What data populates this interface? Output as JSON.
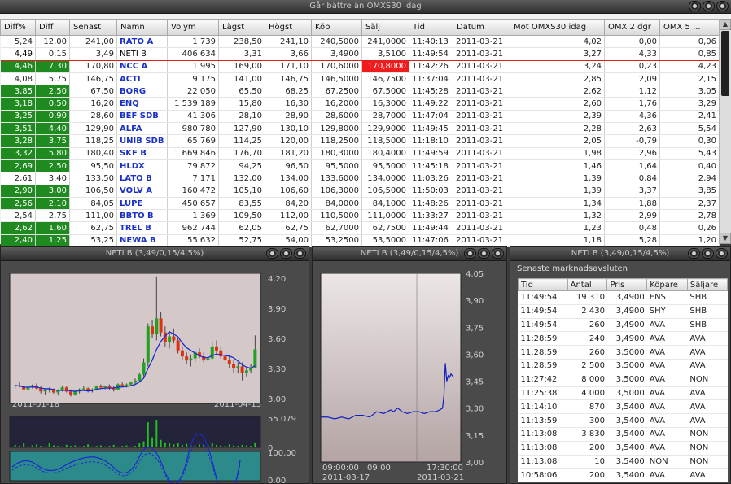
{
  "window": {
    "title": "Går bättre än OMXS30 idag"
  },
  "columns": [
    "Diff%",
    "Diff",
    "Senast",
    "Namn",
    "Volym",
    "Lägst",
    "Högst",
    "Köp",
    "Sälj",
    "Tid",
    "Datum",
    "Mot OMXS30 idag",
    "OMX 2 dgr",
    "OMX 5 ..."
  ],
  "rows": [
    [
      "5,24",
      "12,00",
      "241,00",
      "RATO A",
      "1 739",
      "238,50",
      "241,10",
      "240,5000",
      "241,0000",
      "11:40:13",
      "2011-03-21",
      "4,02",
      "0,00",
      "0,06"
    ],
    [
      "4,49",
      "0,15",
      "3,49",
      "NETI B",
      "406 634",
      "3,31",
      "3,66",
      "3,4900",
      "3,5100",
      "11:49:54",
      "2011-03-21",
      "3,27",
      "4,33",
      "0,85"
    ],
    [
      "4,46",
      "7,30",
      "170,80",
      "NCC A",
      "1 995",
      "169,00",
      "171,10",
      "170,6000",
      "170,8000",
      "11:42:26",
      "2011-03-21",
      "3,24",
      "0,23",
      "4,23"
    ],
    [
      "4,08",
      "5,75",
      "146,75",
      "ACTI",
      "9 175",
      "141,00",
      "146,75",
      "146,5000",
      "146,7500",
      "11:37:04",
      "2011-03-21",
      "2,85",
      "2,09",
      "2,15"
    ],
    [
      "3,85",
      "2,50",
      "67,50",
      "BORG",
      "22 050",
      "65,50",
      "68,25",
      "67,2500",
      "67,5000",
      "11:45:28",
      "2011-03-21",
      "2,62",
      "1,12",
      "3,05"
    ],
    [
      "3,18",
      "0,50",
      "16,20",
      "ENQ",
      "1 539 189",
      "15,80",
      "16,30",
      "16,2000",
      "16,3000",
      "11:49:22",
      "2011-03-21",
      "2,60",
      "1,76",
      "3,29"
    ],
    [
      "3,25",
      "0,90",
      "28,60",
      "BEF SDB",
      "41 306",
      "28,10",
      "28,90",
      "28,6000",
      "28,7000",
      "11:47:04",
      "2011-03-21",
      "2,39",
      "4,36",
      "2,41"
    ],
    [
      "3,51",
      "4,40",
      "129,90",
      "ALFA",
      "980 780",
      "127,90",
      "130,10",
      "129,8000",
      "129,9000",
      "11:49:45",
      "2011-03-21",
      "2,28",
      "2,63",
      "5,54"
    ],
    [
      "3,28",
      "3,75",
      "118,25",
      "UNIB SDB",
      "65 769",
      "114,25",
      "120,00",
      "118,2500",
      "118,5000",
      "11:18:10",
      "2011-03-21",
      "2,05",
      "-0,79",
      "0,30"
    ],
    [
      "3,32",
      "5,80",
      "180,40",
      "SKF B",
      "1 669 846",
      "176,70",
      "181,20",
      "180,3000",
      "180,4000",
      "11:49:59",
      "2011-03-21",
      "1,98",
      "2,96",
      "5,43"
    ],
    [
      "2,69",
      "2,50",
      "95,50",
      "HLDX",
      "79 872",
      "94,25",
      "96,50",
      "95,5000",
      "95,5000",
      "11:45:18",
      "2011-03-21",
      "1,46",
      "1,64",
      "0,40"
    ],
    [
      "2,61",
      "3,40",
      "133,50",
      "LATO B",
      "7 171",
      "132,00",
      "134,00",
      "133,6000",
      "134,0000",
      "11:03:26",
      "2011-03-21",
      "1,39",
      "0,84",
      "2,94"
    ],
    [
      "2,90",
      "3,00",
      "106,50",
      "VOLV A",
      "160 472",
      "105,10",
      "106,60",
      "106,3000",
      "106,5000",
      "11:50:03",
      "2011-03-21",
      "1,39",
      "3,37",
      "3,85"
    ],
    [
      "2,56",
      "2,10",
      "84,05",
      "LUPE",
      "450 657",
      "83,55",
      "84,20",
      "84,0000",
      "84,1000",
      "11:48:26",
      "2011-03-21",
      "1,34",
      "1,88",
      "2,37"
    ],
    [
      "2,54",
      "2,75",
      "111,00",
      "BBTO B",
      "1 369",
      "109,50",
      "112,00",
      "110,5000",
      "111,0000",
      "11:33:27",
      "2011-03-21",
      "1,32",
      "2,99",
      "2,78"
    ],
    [
      "2,62",
      "1,60",
      "62,75",
      "TREL B",
      "962 744",
      "62,05",
      "62,75",
      "62,7000",
      "62,7500",
      "11:49:44",
      "2011-03-21",
      "1,23",
      "0,48",
      "0,26"
    ],
    [
      "2,40",
      "1,25",
      "53,25",
      "NEWA B",
      "55 632",
      "52,75",
      "54,00",
      "53,2500",
      "53,5000",
      "11:47:06",
      "2011-03-21",
      "1,18",
      "5,28",
      "1,20"
    ]
  ],
  "rowColors": [
    "w",
    "g",
    "g",
    "w",
    "g",
    "g",
    "g",
    "g",
    "g",
    "g",
    "g",
    "w",
    "g",
    "g",
    "w",
    "g",
    "g"
  ],
  "diffColors": [
    "w",
    "w",
    "g",
    "w",
    "g",
    "g",
    "g",
    "g",
    "g",
    "g",
    "g",
    "w",
    "g",
    "g",
    "w",
    "g",
    "g"
  ],
  "chart1": {
    "title": "NETI B (3,49/0,15/4,5%)",
    "date_start": "2011-01-18",
    "date_end": "2011-04-15",
    "y_ticks": [
      "4,20",
      "3,90",
      "3,60",
      "3,30",
      "3,00"
    ],
    "vol_ticks": [
      "55 079",
      "0"
    ],
    "osc_ticks": [
      "100,00",
      "0,00"
    ]
  },
  "chart2": {
    "title": "NETI B (3,49/0,15/4,5%)",
    "y_ticks": [
      "4,05",
      "3,90",
      "3,75",
      "3,60",
      "3,45",
      "3,30",
      "3,15",
      "3,00"
    ],
    "x_top": [
      "09:00:00",
      "09:00",
      "17:30:00"
    ],
    "x_bot": [
      "2011-03-17",
      "2011-03-21"
    ]
  },
  "trades": {
    "title": "NETI B (3,49/0,15/4,5%)",
    "subtitle": "Senaste marknadsavsluten",
    "headers": [
      "Tid",
      "Antal",
      "Pris",
      "Köpare",
      "Säljare"
    ],
    "rows": [
      [
        "11:49:54",
        "19 310",
        "3,4900",
        "ENS",
        "SHB"
      ],
      [
        "11:49:54",
        "2 430",
        "3,4900",
        "SHY",
        "SHB"
      ],
      [
        "11:49:54",
        "260",
        "3,4900",
        "AVA",
        "SHB"
      ],
      [
        "11:28:59",
        "240",
        "3,4900",
        "AVA",
        "AVA"
      ],
      [
        "11:28:59",
        "260",
        "3,5000",
        "AVA",
        "AVA"
      ],
      [
        "11:28:59",
        "2 500",
        "3,5000",
        "AVA",
        "AVA"
      ],
      [
        "11:27:42",
        "8 000",
        "3,5000",
        "AVA",
        "NON"
      ],
      [
        "11:25:38",
        "4 000",
        "3,5000",
        "AVA",
        "AVA"
      ],
      [
        "11:14:10",
        "870",
        "3,5400",
        "AVA",
        "AVA"
      ],
      [
        "11:13:59",
        "300",
        "3,5400",
        "AVA",
        "AVA"
      ],
      [
        "11:13:08",
        "3 830",
        "3,5400",
        "AVA",
        "NON"
      ],
      [
        "11:13:08",
        "200",
        "3,5400",
        "AVA",
        "NON"
      ],
      [
        "11:13:08",
        "10",
        "3,5400",
        "NON",
        "NON"
      ],
      [
        "10:58:06",
        "200",
        "3,5400",
        "AVA",
        "AVA"
      ]
    ]
  },
  "chart_data": {
    "type": "candlestick",
    "candles": [
      [
        3.12,
        3.14,
        3.1,
        3.13
      ],
      [
        3.13,
        3.16,
        3.11,
        3.12
      ],
      [
        3.12,
        3.13,
        3.08,
        3.09
      ],
      [
        3.09,
        3.12,
        3.07,
        3.11
      ],
      [
        3.11,
        3.14,
        3.1,
        3.13
      ],
      [
        3.13,
        3.15,
        3.09,
        3.1
      ],
      [
        3.1,
        3.12,
        3.05,
        3.07
      ],
      [
        3.07,
        3.1,
        3.04,
        3.08
      ],
      [
        3.08,
        3.11,
        3.06,
        3.09
      ],
      [
        3.09,
        3.1,
        3.05,
        3.06
      ],
      [
        3.06,
        3.09,
        3.03,
        3.08
      ],
      [
        3.08,
        3.12,
        3.07,
        3.11
      ],
      [
        3.11,
        3.12,
        3.06,
        3.07
      ],
      [
        3.07,
        3.09,
        3.02,
        3.04
      ],
      [
        3.04,
        3.08,
        3.03,
        3.07
      ],
      [
        3.07,
        3.1,
        3.05,
        3.09
      ],
      [
        3.09,
        3.12,
        3.08,
        3.1
      ],
      [
        3.1,
        3.11,
        3.06,
        3.08
      ],
      [
        3.08,
        3.1,
        3.06,
        3.09
      ],
      [
        3.09,
        3.13,
        3.08,
        3.12
      ],
      [
        3.12,
        3.14,
        3.1,
        3.11
      ],
      [
        3.11,
        3.13,
        3.09,
        3.12
      ],
      [
        3.12,
        3.14,
        3.08,
        3.1
      ],
      [
        3.1,
        3.12,
        3.07,
        3.09
      ],
      [
        3.09,
        3.15,
        3.08,
        3.14
      ],
      [
        3.14,
        3.16,
        3.12,
        3.13
      ],
      [
        3.13,
        3.15,
        3.11,
        3.14
      ],
      [
        3.14,
        3.17,
        3.12,
        3.16
      ],
      [
        3.16,
        3.2,
        3.14,
        3.18
      ],
      [
        3.18,
        3.26,
        3.16,
        3.24
      ],
      [
        3.24,
        3.4,
        3.22,
        3.36
      ],
      [
        3.36,
        3.75,
        3.32,
        3.72
      ],
      [
        3.72,
        3.78,
        3.6,
        3.64
      ],
      [
        3.64,
        4.22,
        3.58,
        3.8
      ],
      [
        3.8,
        3.86,
        3.62,
        3.66
      ],
      [
        3.66,
        3.72,
        3.52,
        3.56
      ],
      [
        3.56,
        3.66,
        3.5,
        3.62
      ],
      [
        3.62,
        3.7,
        3.55,
        3.58
      ],
      [
        3.58,
        3.6,
        3.45,
        3.48
      ],
      [
        3.48,
        3.52,
        3.38,
        3.42
      ],
      [
        3.42,
        3.46,
        3.34,
        3.38
      ],
      [
        3.38,
        3.44,
        3.32,
        3.4
      ],
      [
        3.4,
        3.48,
        3.36,
        3.46
      ],
      [
        3.46,
        3.5,
        3.4,
        3.42
      ],
      [
        3.42,
        3.46,
        3.36,
        3.38
      ],
      [
        3.38,
        3.44,
        3.34,
        3.4
      ],
      [
        3.4,
        3.56,
        3.38,
        3.52
      ],
      [
        3.52,
        3.58,
        3.44,
        3.48
      ],
      [
        3.48,
        3.52,
        3.4,
        3.42
      ],
      [
        3.42,
        3.46,
        3.36,
        3.38
      ],
      [
        3.38,
        3.42,
        3.3,
        3.34
      ],
      [
        3.34,
        3.38,
        3.26,
        3.3
      ],
      [
        3.3,
        3.36,
        3.25,
        3.32
      ],
      [
        3.32,
        3.36,
        3.18,
        3.26
      ],
      [
        3.26,
        3.3,
        3.22,
        3.28
      ],
      [
        3.28,
        3.34,
        3.25,
        3.31
      ],
      [
        3.31,
        3.63,
        3.3,
        3.49
      ]
    ],
    "volume": [
      5,
      3,
      8,
      2,
      4,
      6,
      3,
      2,
      9,
      4,
      3,
      2,
      5,
      3,
      4,
      2,
      3,
      6,
      2,
      3,
      4,
      2,
      3,
      5,
      2,
      3,
      4,
      2,
      3,
      8,
      12,
      50,
      20,
      55,
      15,
      10,
      8,
      6,
      9,
      5,
      7,
      4,
      3,
      6,
      5,
      4,
      8,
      5,
      4,
      3,
      6,
      4,
      3,
      5,
      4,
      3,
      10
    ],
    "intraday": [
      [
        0,
        3.25
      ],
      [
        0.05,
        3.25
      ],
      [
        0.1,
        3.24
      ],
      [
        0.15,
        3.25
      ],
      [
        0.2,
        3.24
      ],
      [
        0.25,
        3.26
      ],
      [
        0.3,
        3.26
      ],
      [
        0.35,
        3.25
      ],
      [
        0.4,
        3.28
      ],
      [
        0.45,
        3.27
      ],
      [
        0.5,
        3.29
      ],
      [
        0.52,
        3.28
      ],
      [
        0.55,
        3.3
      ],
      [
        0.58,
        3.28
      ],
      [
        0.62,
        3.27
      ],
      [
        0.66,
        3.28
      ],
      [
        0.7,
        3.28
      ],
      [
        0.74,
        3.27
      ],
      [
        0.78,
        3.28
      ],
      [
        0.82,
        3.28
      ],
      [
        0.85,
        3.29
      ],
      [
        0.87,
        3.3
      ],
      [
        0.88,
        3.37
      ],
      [
        0.89,
        3.55
      ],
      [
        0.9,
        3.45
      ],
      [
        0.91,
        3.48
      ],
      [
        0.92,
        3.47
      ],
      [
        0.93,
        3.49
      ],
      [
        0.95,
        3.47
      ]
    ]
  }
}
